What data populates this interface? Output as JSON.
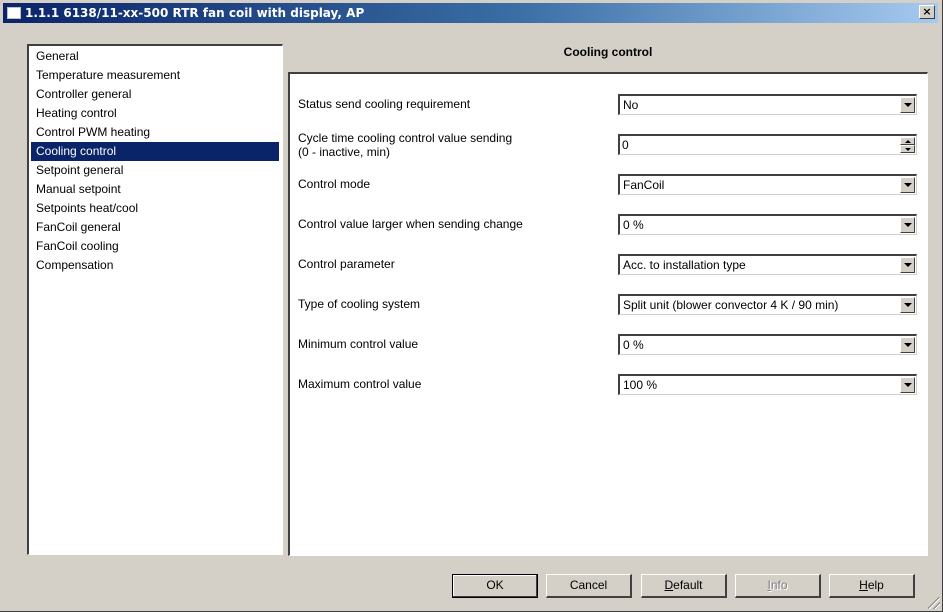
{
  "window": {
    "title": "1.1.1 6138/11-xx-500 RTR fan coil with display, AP",
    "close_label": "×"
  },
  "nav": {
    "items": [
      "General",
      "Temperature measurement",
      "Controller general",
      "Heating control",
      "Control PWM heating",
      "Cooling control",
      "Setpoint general",
      "Manual setpoint",
      "Setpoints heat/cool",
      "FanCoil general",
      "FanCoil cooling",
      "Compensation"
    ],
    "selected_index": 5
  },
  "panel": {
    "title": "Cooling control",
    "params": [
      {
        "label": "Status send cooling requirement",
        "value": "No",
        "kind": "dropdown"
      },
      {
        "label": "Cycle time cooling control value sending",
        "label2": "(0 - inactive, min)",
        "value": "0",
        "kind": "spinner"
      },
      {
        "label": "Control mode",
        "value": "FanCoil",
        "kind": "dropdown"
      },
      {
        "label": "Control value larger when sending change",
        "value": "0 %",
        "kind": "dropdown"
      },
      {
        "label": "Control parameter",
        "value": "Acc. to installation type",
        "kind": "dropdown"
      },
      {
        "label": "Type of cooling system",
        "value": "Split unit (blower convector 4 K / 90 min)",
        "kind": "dropdown"
      },
      {
        "label": "Minimum control value",
        "value": "0 %",
        "kind": "dropdown"
      },
      {
        "label": "Maximum control value",
        "value": "100 %",
        "kind": "dropdown"
      }
    ]
  },
  "buttons": {
    "ok": "OK",
    "cancel": "Cancel",
    "default_first": "D",
    "default_rest": "efault",
    "info_first": "I",
    "info_rest": "nfo",
    "help_first": "H",
    "help_rest": "elp"
  },
  "colors": {
    "selection": "#0a246a",
    "face": "#d4d0c8"
  }
}
